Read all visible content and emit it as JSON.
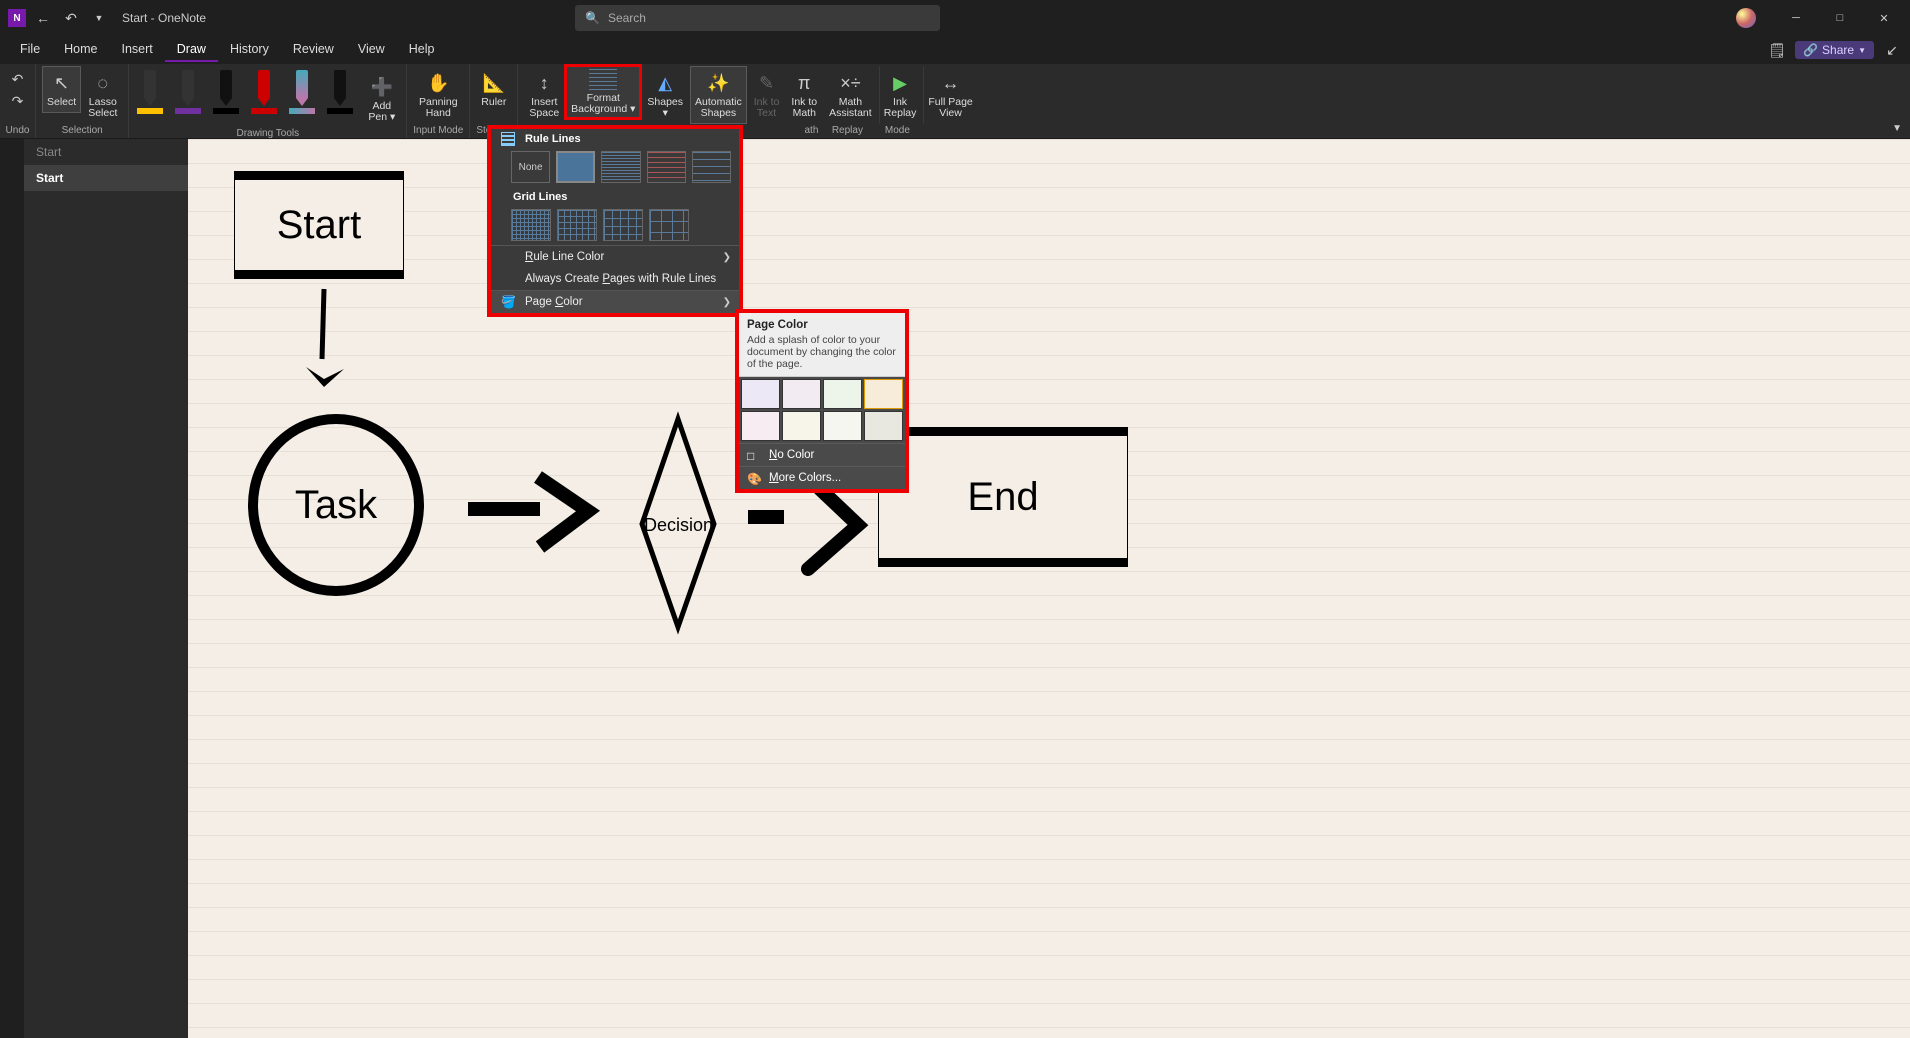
{
  "titlebar": {
    "app_initial": "N",
    "title": "Start - OneNote",
    "search_placeholder": "Search"
  },
  "menus": {
    "file": "File",
    "home": "Home",
    "insert": "Insert",
    "draw": "Draw",
    "history": "History",
    "review": "Review",
    "view": "View",
    "help": "Help",
    "share": "Share"
  },
  "ribbon": {
    "undo_group": "Undo",
    "selection_group": "Selection",
    "select": "Select",
    "lasso": "Lasso\nSelect",
    "drawing_tools_group": "Drawing Tools",
    "add_pen": "Add\nPen ▾",
    "input_mode_group": "Input Mode",
    "panning_hand": "Panning\nHand",
    "stencils_group": "Stencils",
    "ruler": "Ruler",
    "insert_space": "Insert\nSpace",
    "format_bg": "Format\nBackground ▾",
    "shapes": "Shapes\n▾",
    "auto_shapes": "Automatic\nShapes",
    "ink_to_text": "Ink to\nText",
    "ink_to_math": "Ink to\nMath",
    "math_assistant": "Math\nAssistant",
    "ink_replay": "Ink\nReplay",
    "full_page": "Full Page\nView",
    "math_group": "ath",
    "replay_group": "Replay",
    "mode_group": "Mode"
  },
  "dropdown": {
    "rule_lines_header": "Rule Lines",
    "none": "None",
    "grid_lines_header": "Grid Lines",
    "rule_line_color": "Rule Line Color",
    "always_create": "Always Create Pages with Rule Lines",
    "page_color": "Page Color"
  },
  "flyout": {
    "title": "Page Color",
    "description": "Add a splash of color to your document by changing the color of the page.",
    "colors_row1": [
      "#ece8f6",
      "#f2ecf2",
      "#edf4e9",
      "#f7ecda"
    ],
    "colors_row2": [
      "#f6ecf2",
      "#f7f4e9",
      "#f6f6f0",
      "#e8e8e0"
    ],
    "no_color": "No Color",
    "more_colors": "More Colors..."
  },
  "pagelist": {
    "prev": "Start",
    "current": "Start"
  },
  "shapes": {
    "start": "Start",
    "task": "Task",
    "decision": "Decision",
    "end": "End"
  }
}
